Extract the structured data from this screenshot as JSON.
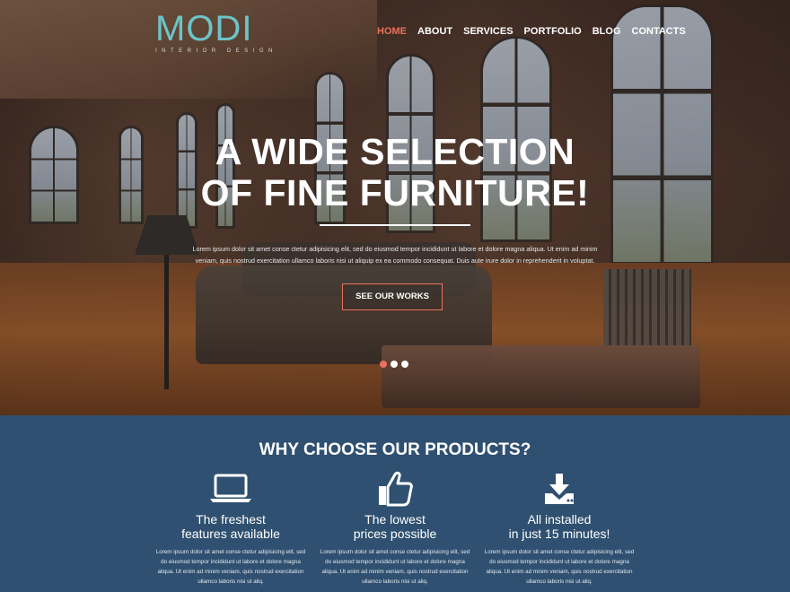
{
  "brand": {
    "name": "MODI",
    "tagline": "INTERIOR DESIGN",
    "accent": "#e9715d",
    "logo_color": "#6cc4c8"
  },
  "nav": [
    {
      "label": "HOME",
      "active": true
    },
    {
      "label": "ABOUT",
      "active": false
    },
    {
      "label": "SERVICES",
      "active": false
    },
    {
      "label": "PORTFOLIO",
      "active": false
    },
    {
      "label": "BLOG",
      "active": false
    },
    {
      "label": "CONTACTS",
      "active": false
    }
  ],
  "hero": {
    "title_line1": "A WIDE SELECTION",
    "title_line2": "OF FINE FURNITURE!",
    "text": "Lorem ipsum dolor sit amet conse ctetur adipisicing elit, sed do eiusmod tempor incididunt ut labore et dolore magna aliqua. Ut enim ad minim veniam, quis nostrud exercitation ullamco laboris nisi ut aliquip ex ea commodo consequat. Duis aute irure dolor in reprehenderit in voluptat.",
    "button_label": "SEE OUR WORKS",
    "slides": 3,
    "active_slide": 1
  },
  "features": {
    "title": "WHY CHOOSE OUR PRODUCTS?",
    "items": [
      {
        "icon": "laptop-icon",
        "line1": "The freshest",
        "line2": "features available",
        "text": "Lorem ipsum dolor sit amet conse ctetur adipisicing elit, sed do eiusmod tempor incididunt ut labore et dolore magna aliqua. Ut enim ad minim veniam, quis nostrud exercitation ullamco laboris nisi ut aliq."
      },
      {
        "icon": "thumbs-up-icon",
        "line1": "The lowest",
        "line2": "prices possible",
        "text": "Lorem ipsum dolor sit amet conse ctetur adipisicing elit, sed do eiusmod tempor incididunt ut labore et dolore magna aliqua. Ut enim ad minim veniam, quis nostrud exercitation ullamco laboris nisi ut aliq."
      },
      {
        "icon": "download-icon",
        "line1": "All installed",
        "line2": "in just 15 minutes!",
        "text": "Lorem ipsum dolor sit amet conse ctetur adipisicing elit, sed do eiusmod tempor incididunt ut labore et dolore magna aliqua. Ut enim ad minim veniam, quis nostrud exercitation ullamco laboris nisi ut aliq."
      }
    ]
  }
}
